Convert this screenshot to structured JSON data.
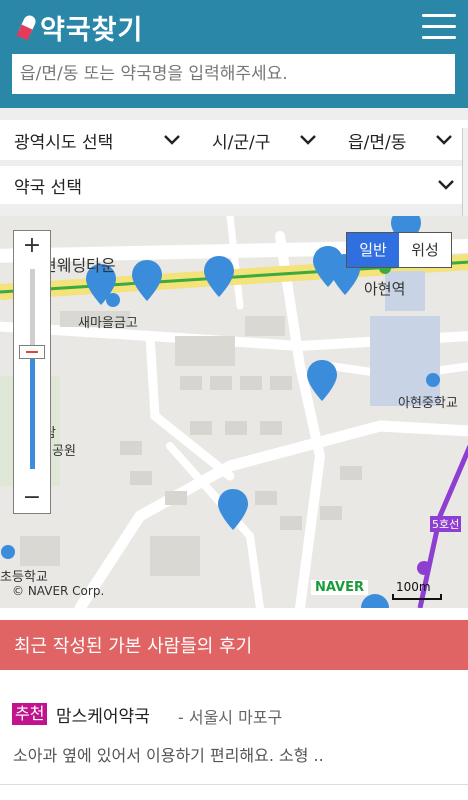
{
  "header": {
    "title": "약국찾기",
    "menu_icon": "hamburger-icon",
    "logo_icon": "pill-icon"
  },
  "search": {
    "placeholder": "읍/면/동 또는 약국명을 입력해주세요."
  },
  "filters": {
    "province": "광역시도 선택",
    "district": "시/군/구",
    "town": "읍/면/동",
    "pharmacy": "약국 선택"
  },
  "map": {
    "zoom_in": "+",
    "zoom_out": "−",
    "type_normal": "일반",
    "type_satellite": "위성",
    "labels": {
      "area": "현웨딩타운",
      "bank": "새마을금고",
      "station": "아현역",
      "school_middle": "아현중학교",
      "park_a": "공원",
      "park_b": "람",
      "school_elem": "초등학교",
      "road": "5호선"
    },
    "attribution": "© NAVER Corp.",
    "brand": "NAVER",
    "scale": "100m"
  },
  "reviews": {
    "banner": "최근 작성된 가본 사람들의 후기",
    "items": [
      {
        "badge": "추천",
        "name": "맘스케어약국",
        "location": "- 서울시 마포구",
        "text": "소아과 옆에 있어서 이용하기 편리해요. 소형 .."
      }
    ]
  },
  "colors": {
    "header": "#2a87a8",
    "banner": "#e06464",
    "badge": "#c0138e",
    "marker": "#3b8ddb"
  }
}
